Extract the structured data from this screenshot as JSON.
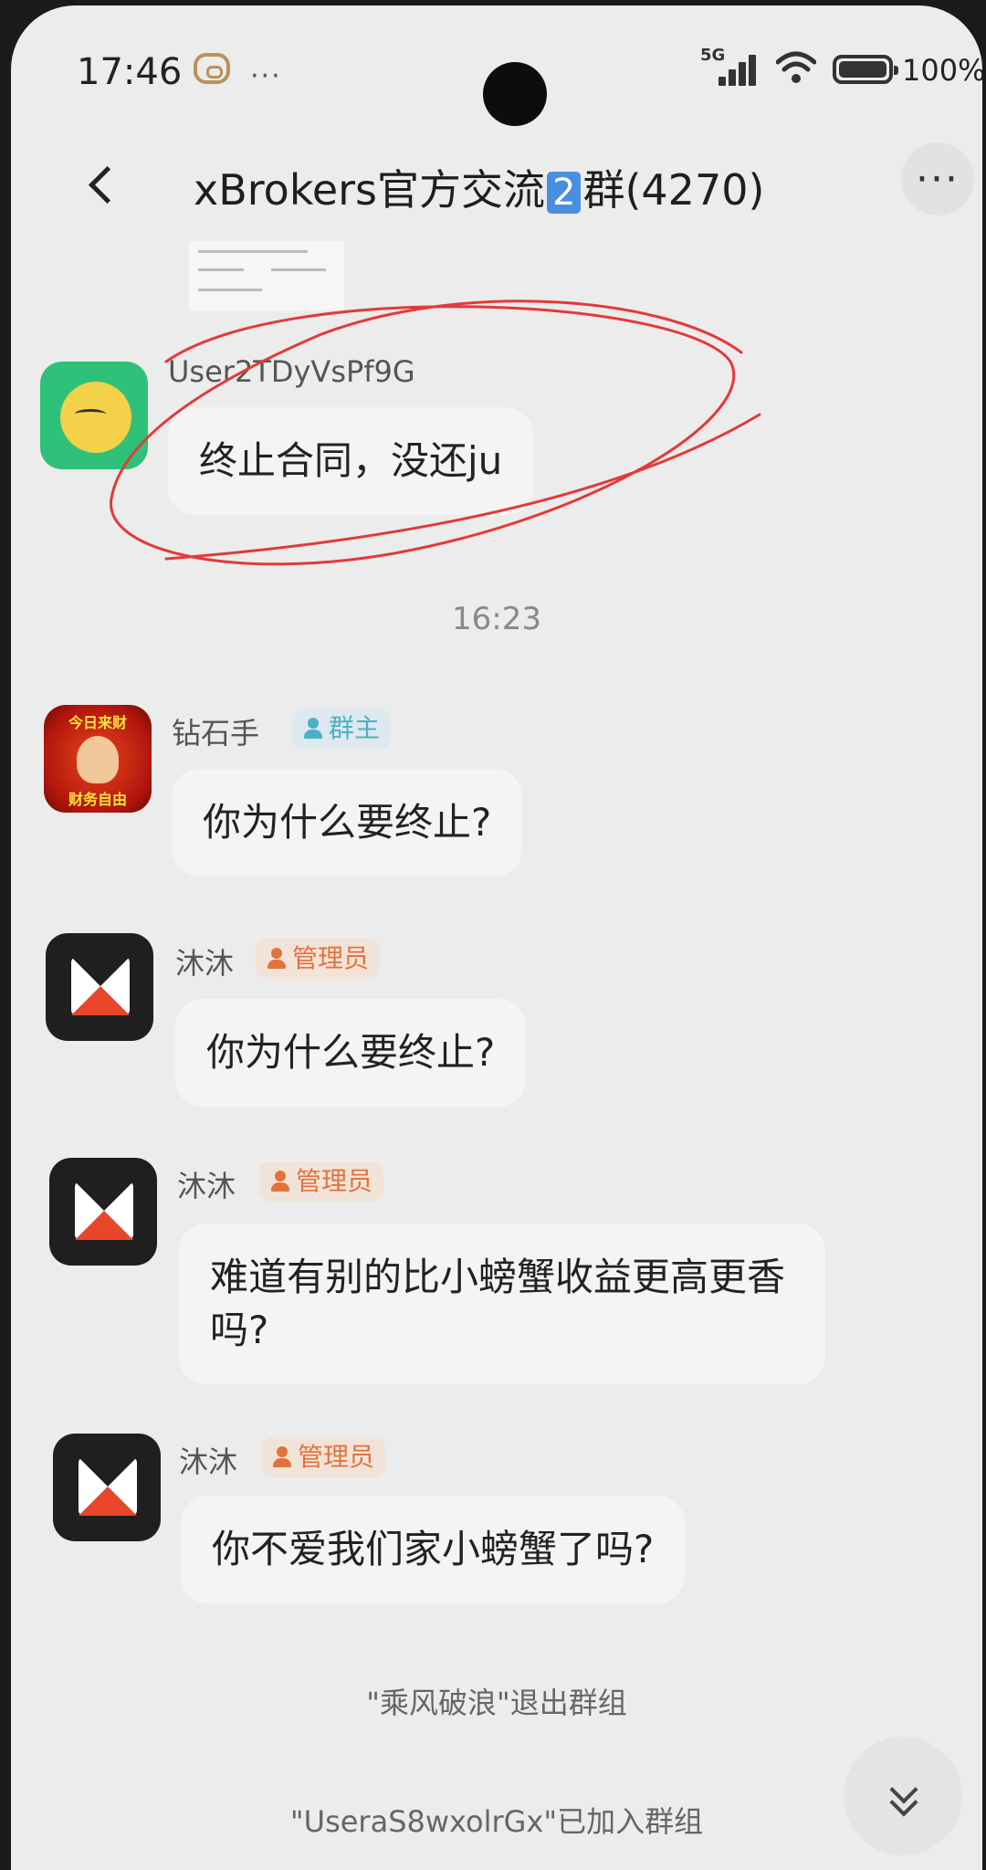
{
  "status_bar": {
    "time": "17:46",
    "network": "5G",
    "battery": "100%"
  },
  "header": {
    "title_prefix": "xBrokers官方交流",
    "title_badge": "2",
    "title_suffix": "群(4270)",
    "more_label": "···"
  },
  "messages": [
    {
      "sender": "User2TDyVsPf9G",
      "text": "终止合同，没还ju"
    },
    {
      "sender": "钻石手",
      "role": "群主",
      "text": "你为什么要终止?"
    },
    {
      "sender": "沐沐",
      "role": "管理员",
      "text": "你为什么要终止?"
    },
    {
      "sender": "沐沐",
      "role": "管理员",
      "text": "难道有别的比小螃蟹收益更高更香吗?"
    },
    {
      "sender": "沐沐",
      "role": "管理员",
      "text": "你不爱我们家小螃蟹了吗?"
    }
  ],
  "timestamp": "16:23",
  "avatar_texts": {
    "top": "今日来财",
    "bottom": "财务自由"
  },
  "system_messages": [
    "\"乘风破浪\"退出群组",
    "\"UseraS8wxolrGx\"已加入群组"
  ],
  "annotation_color": "#e23a3a"
}
